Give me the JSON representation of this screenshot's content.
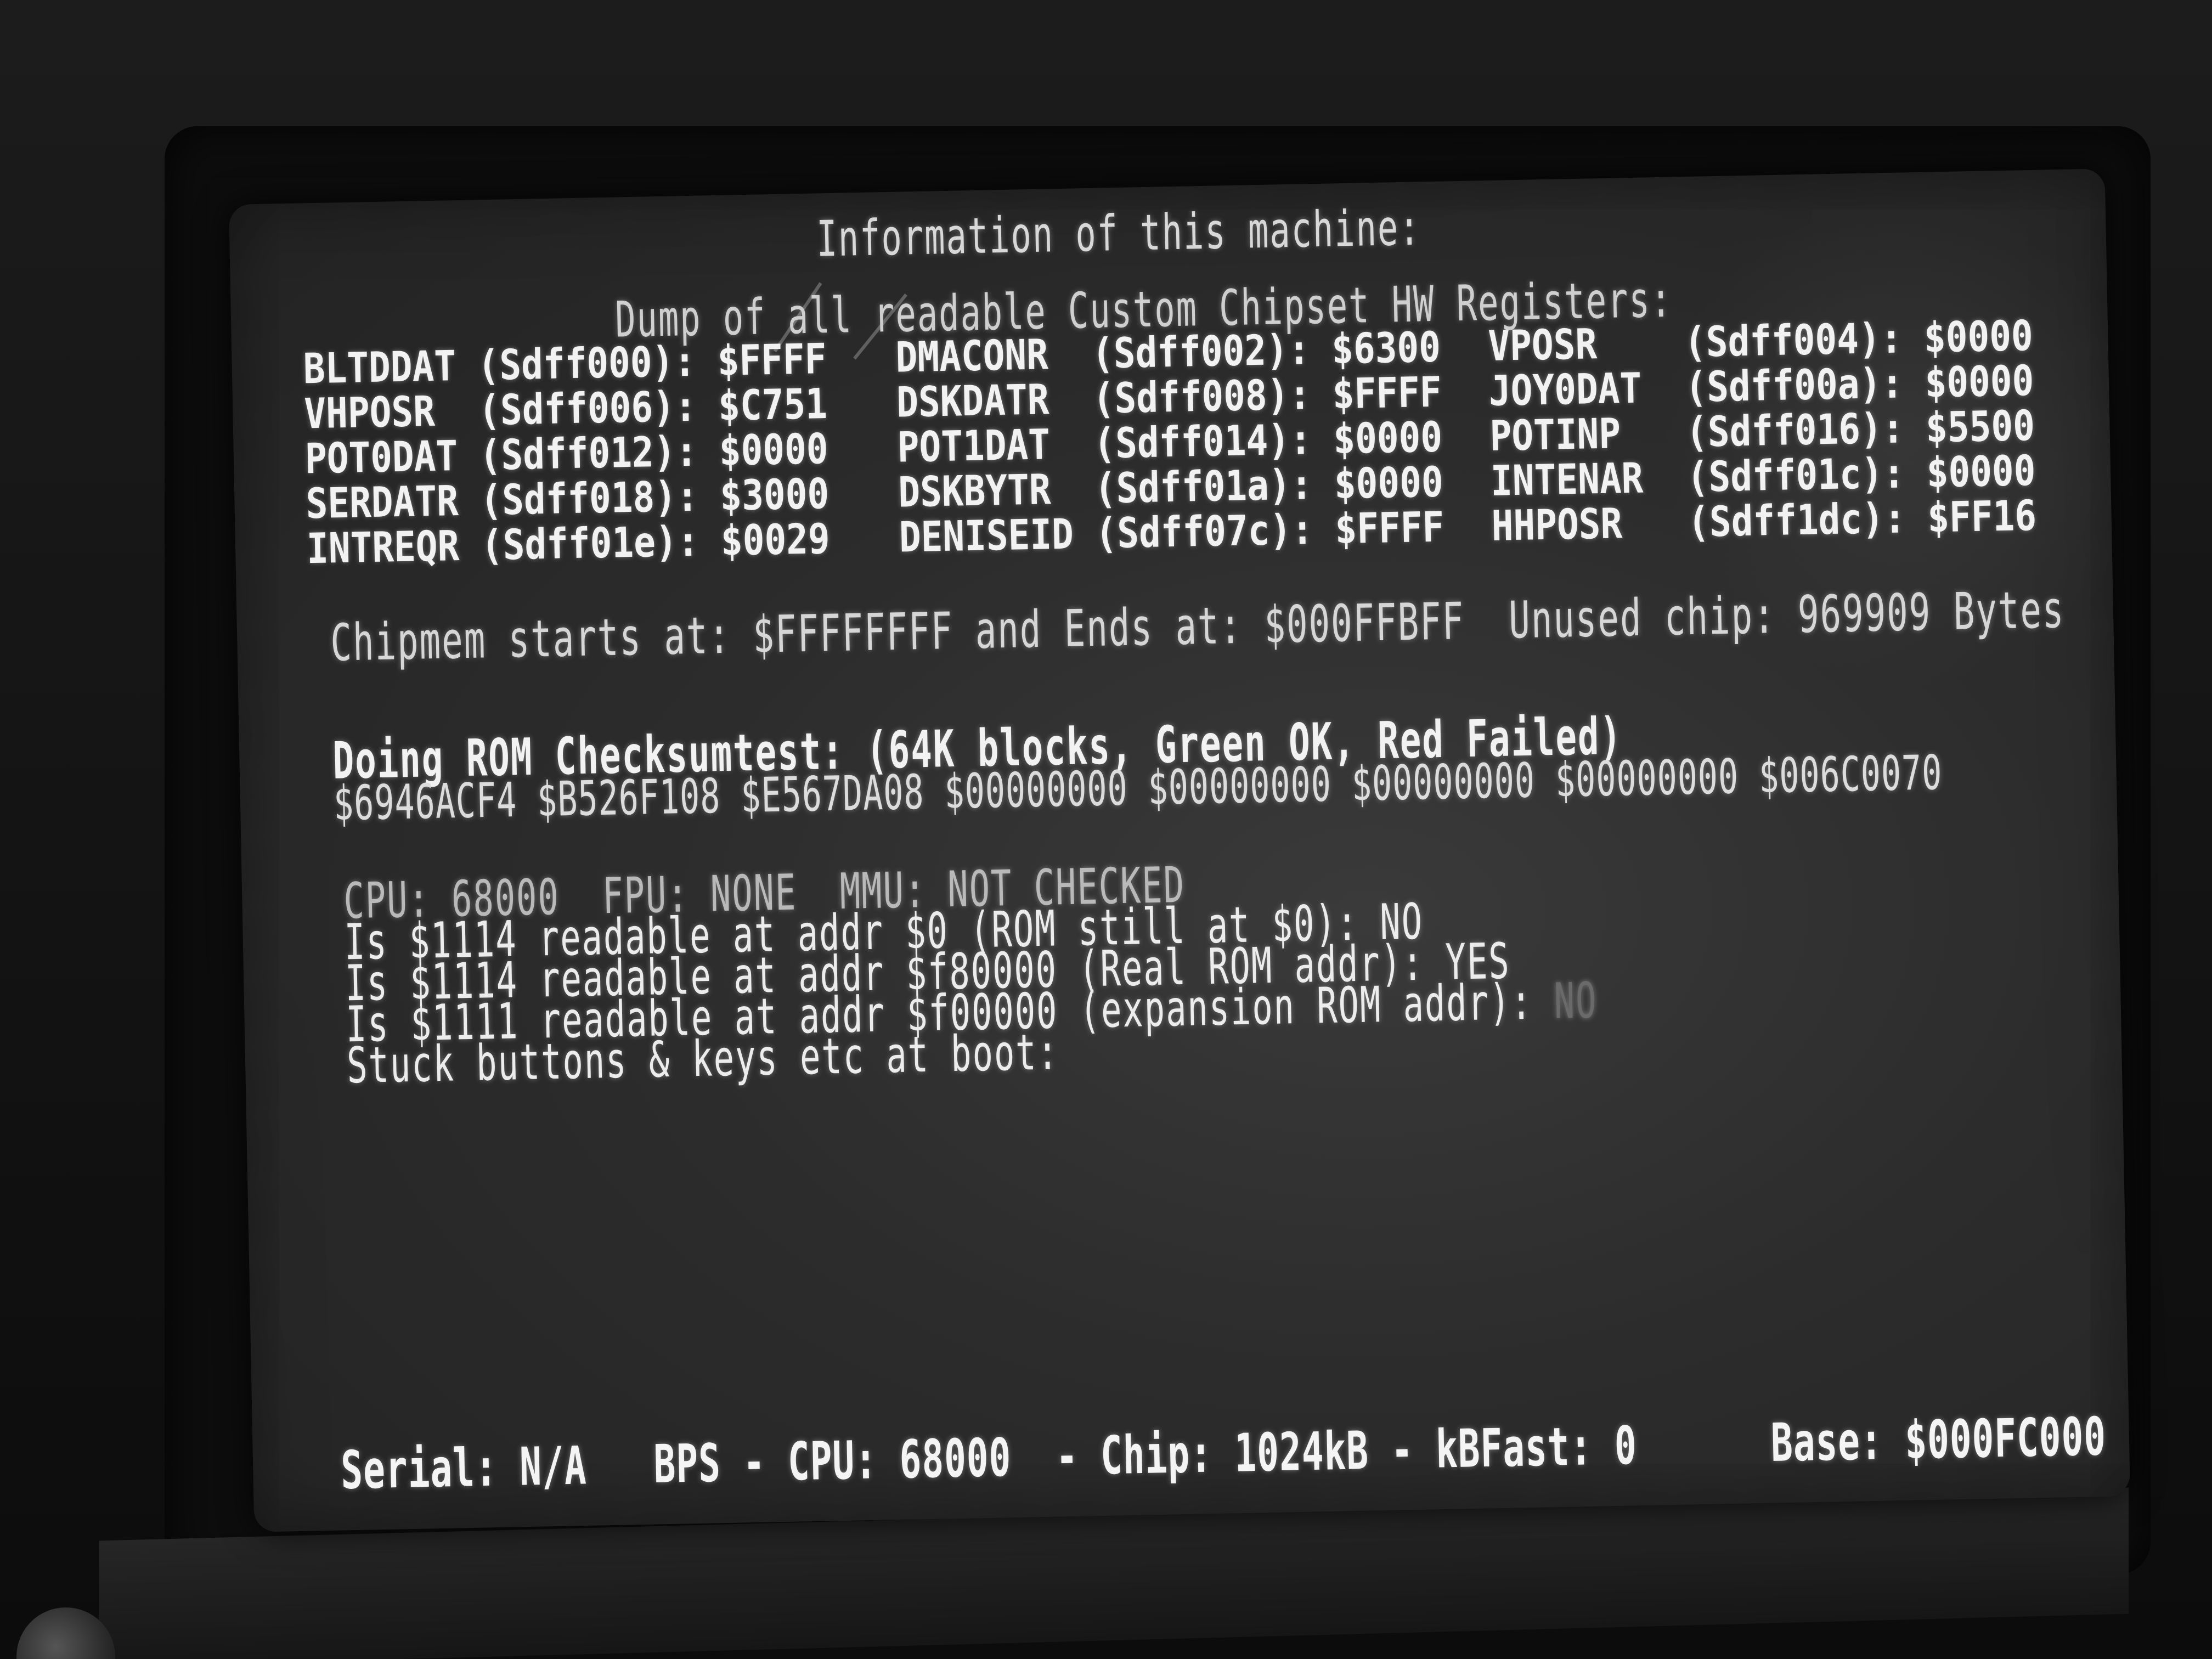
{
  "screen": {
    "title": "Information of this machine:",
    "subtitle": "Dump of all readable Custom Chipset HW Registers:",
    "registers": [
      {
        "text": "BLTDDAT (Sdff000): $FFFF"
      },
      {
        "text": "DMACONR  (Sdff002): $6300"
      },
      {
        "text": "VPOSR    (Sdff004): $0000"
      },
      {
        "text": "VHPOSR  (Sdff006): $C751"
      },
      {
        "text": "DSKDATR  (Sdff008): $FFFF"
      },
      {
        "text": "JOY0DAT  (Sdff00a): $0000"
      },
      {
        "text": "POT0DAT (Sdff012): $0000"
      },
      {
        "text": "POT1DAT  (Sdff014): $0000"
      },
      {
        "text": "POTINP   (Sdff016): $5500"
      },
      {
        "text": "SERDATR (Sdff018): $3000"
      },
      {
        "text": "DSKBYTR  (Sdff01a): $0000"
      },
      {
        "text": "INTENAR  (Sdff01c): $0000"
      },
      {
        "text": "INTREQR (Sdff01e): $0029"
      },
      {
        "text": "DENISEID (Sdff07c): $FFFF"
      },
      {
        "text": "HHPOSR   (Sdff1dc): $FF16"
      }
    ],
    "chipmem": "Chipmem starts at: $FFFFFFFF and Ends at: $000FFBFF  Unused chip: 969909 Bytes",
    "rom_header": "Doing ROM Checksumtest: (64K blocks, Green OK, Red Failed)",
    "rom_values": "$6946ACF4 $B526F108 $E567DA08 $00000000 $00000000 $00000000 $00000000 $006C0070",
    "cpu_line": "CPU: 68000  FPU: NONE  MMU: NOT CHECKED",
    "check1": "Is $1114 readable at addr $0 (ROM still at $0): NO",
    "check2": "Is $1114 readable at addr $f80000 (Real ROM addr): YES",
    "check3": "Is $1111 readable at addr $f00000 (expansion ROM addr):",
    "check3_result": "NO",
    "stuck": "Stuck buttons & keys etc at boot:",
    "status_bar": "Serial: N/A   BPS - CPU: 68000  - Chip: 1024kB - kBFast: 0      Base: $000FC000"
  }
}
